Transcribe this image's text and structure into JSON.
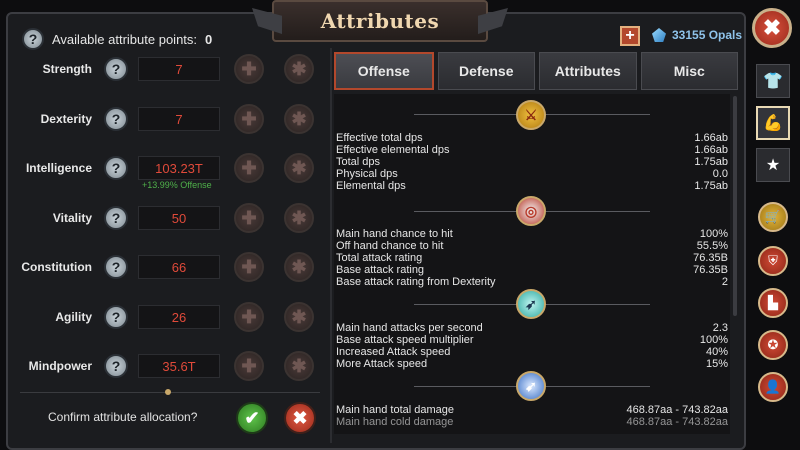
{
  "title": "Attributes",
  "available": {
    "label": "Available attribute points:",
    "value": "0"
  },
  "currency": {
    "plus": "+",
    "opals": "33155 Opals"
  },
  "close": "✖",
  "attributes": [
    {
      "name": "Strength",
      "value": "7"
    },
    {
      "name": "Dexterity",
      "value": "7"
    },
    {
      "name": "Intelligence",
      "value": "103.23T"
    },
    {
      "name": "Vitality",
      "value": "50"
    },
    {
      "name": "Constitution",
      "value": "66"
    },
    {
      "name": "Agility",
      "value": "26"
    },
    {
      "name": "Mindpower",
      "value": "35.6T"
    }
  ],
  "intelligence_note": "+13.99% Offense",
  "confirm": {
    "text": "Confirm attribute allocation?",
    "ok": "✔",
    "cancel": "✖"
  },
  "tabs": [
    "Offense",
    "Defense",
    "Attributes",
    "Misc"
  ],
  "stats": {
    "s1": [
      [
        "Effective total dps",
        "1.66ab"
      ],
      [
        "Effective elemental dps",
        "1.66ab"
      ],
      [
        "Total dps",
        "1.75ab"
      ],
      [
        "Physical dps",
        "0.0"
      ],
      [
        "Elemental dps",
        "1.75ab"
      ]
    ],
    "s2": [
      [
        "Main hand chance to hit",
        "100%"
      ],
      [
        "Off hand chance to hit",
        "55.5%"
      ],
      [
        "Total attack rating",
        "76.35B"
      ],
      [
        "Base attack rating",
        "76.35B"
      ],
      [
        "Base attack rating from Dexterity",
        "2"
      ]
    ],
    "s3": [
      [
        "Main hand attacks per second",
        "2.3"
      ],
      [
        "Base attack speed multiplier",
        "100%"
      ],
      [
        "Increased Attack speed",
        "40%"
      ],
      [
        "More Attack speed",
        "15%"
      ]
    ],
    "s4": [
      [
        "Main hand total damage",
        "468.87aa - 743.82aa"
      ],
      [
        "Main hand cold damage",
        "468.87aa - 743.82aa"
      ]
    ]
  },
  "icons": {
    "help": "?",
    "plus": "✚",
    "star": "✱",
    "sections": [
      "crossed-swords-icon",
      "target-icon",
      "arrow-icon",
      "speed-icon"
    ],
    "side_tabs": [
      "shirt-icon",
      "arm-flex-icon",
      "star-icon"
    ],
    "side_round": [
      "shop-icon",
      "shield-icon",
      "podium-icon",
      "medal-icon",
      "add-friend-icon"
    ]
  },
  "colors": {
    "accent_red": "#b3482c",
    "value_red": "#e04a3a",
    "bonus_green": "#4fb04a",
    "opal_blue": "#8fc3ea"
  }
}
